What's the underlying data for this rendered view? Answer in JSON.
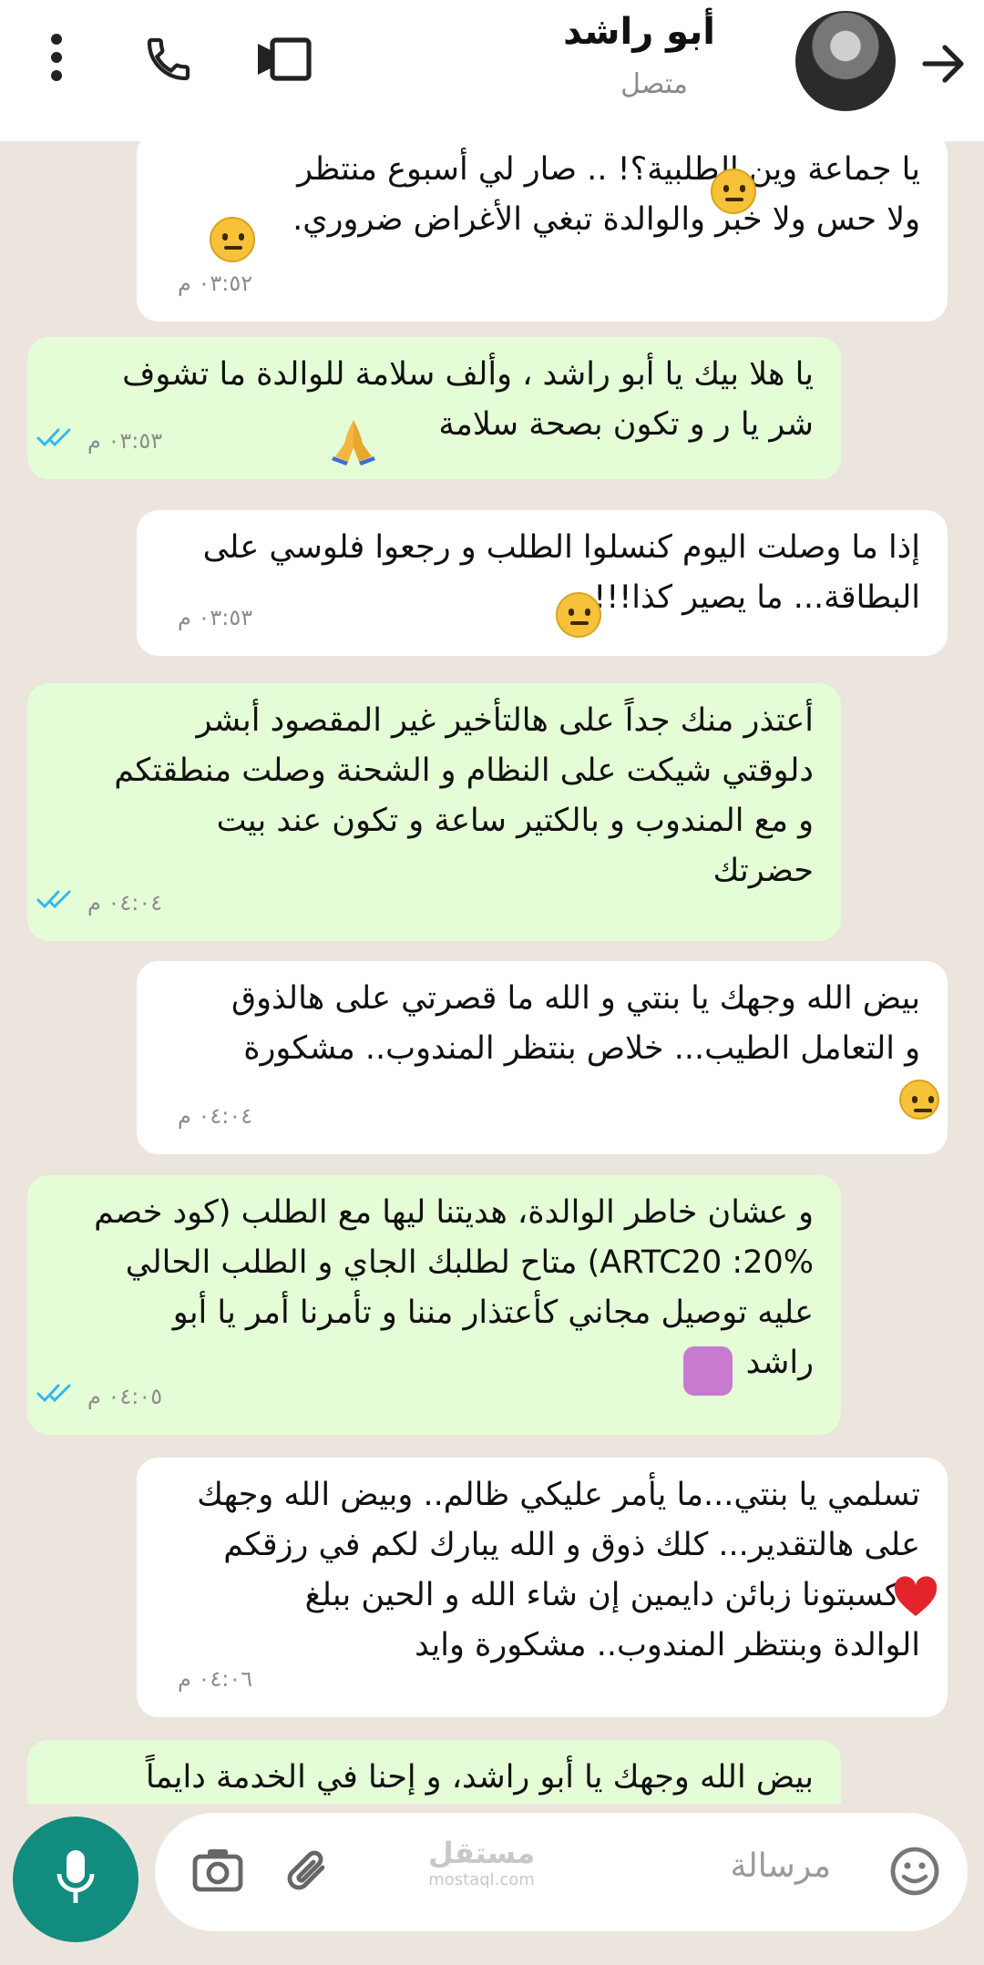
{
  "header": {
    "name": "أبو راشد",
    "status": "متصل"
  },
  "messages": [
    {
      "text": "يا جماعة وين الطلبية؟! .. صار لي أسبوع منتظر\nولا حس ولا خبر والوالدة تبغي الأغراض ضروري.",
      "time": "٠٣:٥٢ م"
    },
    {
      "text": "يا هلا بيك يا أبو راشد ، وألف سلامة للوالدة ما تشوف\nشر يا ر و تكون بصحة  سلامة",
      "time": "٠٣:٥٣ م"
    },
    {
      "text": "إذا ما وصلت اليوم كنسلوا الطلب و رجعوا فلوسي على\nالبطاقة... ما يصير كذا!!!",
      "time": "٠٣:٥٣ م"
    },
    {
      "text": "أعتذر منك جداً على هالتأخير غير المقصود أبشر\nدلوقتي شيكت على النظام و الشحنة وصلت منطقتكم\nو مع المندوب و بالكتير ساعة و تكون عند بيت\nحضرتك",
      "time": "٠٤:٠٤ م"
    },
    {
      "text": "بيض الله وجهك يا بنتي و الله ما قصرتي على هالذوق\nو التعامل الطيب... خلاص بنتظر المندوب.. مشكورة",
      "time": "٠٤:٠٤ م"
    },
    {
      "text": "و عشان خاطر الوالدة، هديتنا ليها مع الطلب (كود خصم\n20%: ARTC20) متاح لطلبك الجاي و الطلب الحالي\nعليه توصيل مجاني كأعتذار مننا و تأمرنا أمر يا أبو\nراشد",
      "time": "٠٤:٠٥ م"
    },
    {
      "text": "تسلمي يا بنتي...ما يأمر عليكي ظالم.. وبيض الله وجهك\nعلى هالتقدير... كلك ذوق و الله يبارك لكم في رزقكم\n، كسبتونا زبائن دايمين إن شاء الله و الحين ببلغ\nالوالدة وبنتظر المندوب.. مشكورة وايد",
      "time": "٠٤:٠٦ م"
    },
    {
      "text": "بيض الله وجهك يا أبو راشد، و إحنا في الخدمة دايماً"
    }
  ],
  "composer": {
    "placeholder": "مرسالة"
  },
  "watermark": {
    "arabic": "مستقل",
    "latin": "mostaql.com"
  },
  "icons": [
    "more-icon",
    "phone-icon",
    "video-icon",
    "back-arrow-icon",
    "emoji-icon",
    "attach-icon",
    "camera-icon",
    "mic-icon",
    "double-check-icon"
  ],
  "colors": {
    "incoming": "#ffffff",
    "outgoing": "#e5fdd6",
    "accent": "#128c7e",
    "read_ticks": "#34b7f1"
  }
}
